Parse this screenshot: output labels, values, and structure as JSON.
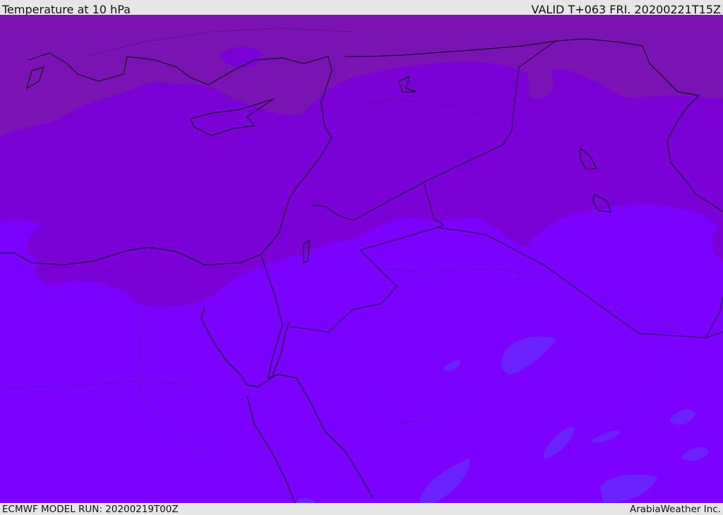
{
  "header": {
    "title": "Temperature at 10 hPa",
    "valid": "VALID T+063 FRI. 20200221T15Z"
  },
  "footer": {
    "model_run": "ECMWF MODEL RUN: 20200219T00Z",
    "credit": "ArabiaWeather Inc."
  },
  "colors": {
    "band_cold": "#7a12b4",
    "band_mid": "#7a00d6",
    "band_warm": "#7b00ff",
    "band_warmest": "#6a22ff",
    "coastline": "#000000"
  }
}
